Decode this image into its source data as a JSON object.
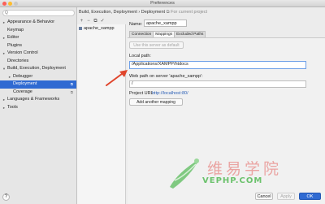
{
  "window": {
    "title": "Preferences"
  },
  "search": {
    "placeholder": "Q"
  },
  "sidebar": {
    "items": [
      {
        "label": "Appearance & Behavior",
        "arrow": "▸",
        "indent": 0,
        "selected": false,
        "badge": ""
      },
      {
        "label": "Keymap",
        "arrow": "",
        "indent": 0,
        "selected": false,
        "badge": ""
      },
      {
        "label": "Editor",
        "arrow": "▸",
        "indent": 0,
        "selected": false,
        "badge": ""
      },
      {
        "label": "Plugins",
        "arrow": "",
        "indent": 0,
        "selected": false,
        "badge": ""
      },
      {
        "label": "Version Control",
        "arrow": "▸",
        "indent": 0,
        "selected": false,
        "badge": ""
      },
      {
        "label": "Directories",
        "arrow": "",
        "indent": 0,
        "selected": false,
        "badge": ""
      },
      {
        "label": "Build, Execution, Deployment",
        "arrow": "▾",
        "indent": 0,
        "selected": false,
        "badge": ""
      },
      {
        "label": "Debugger",
        "arrow": "▸",
        "indent": 1,
        "selected": false,
        "badge": ""
      },
      {
        "label": "Deployment",
        "arrow": "",
        "indent": 1,
        "selected": true,
        "badge": "⧉"
      },
      {
        "label": "Coverage",
        "arrow": "",
        "indent": 1,
        "selected": false,
        "badge": "⧉"
      },
      {
        "label": "Languages & Frameworks",
        "arrow": "▸",
        "indent": 0,
        "selected": false,
        "badge": ""
      },
      {
        "label": "Tools",
        "arrow": "▸",
        "indent": 0,
        "selected": false,
        "badge": ""
      }
    ]
  },
  "breadcrumb": {
    "path": "Build, Execution, Deployment › Deployment",
    "project_note": "⧉ For current project"
  },
  "toolbar": {
    "add": "+",
    "remove": "−",
    "copy": "⧉",
    "default": "✓"
  },
  "server": {
    "name": "apache_xampp"
  },
  "form": {
    "name_label": "Name:",
    "name_value": "apache_xampp",
    "tabs": [
      "Connection",
      "Mappings",
      "Excluded Paths"
    ],
    "use_default_label": "Use this server as default",
    "local_path_label": "Local path:",
    "local_path_value": "/Applications/XAMPP/htdocs",
    "web_path_label": "Web path on server 'apache_xampp':",
    "web_path_value": "/",
    "project_url_label": "Project URL:",
    "project_url_value": "http://localhost:80/",
    "add_mapping_label": "Add another mapping"
  },
  "buttons": {
    "help": "?",
    "cancel": "Cancel",
    "apply": "Apply",
    "ok": "OK"
  },
  "watermark": {
    "chinese": "维易学院",
    "url": "VEPHP.COM"
  },
  "colors": {
    "accent": "#2f6ad2",
    "annotation_arrow": "#e0452c",
    "watermark_text": "#eaa4a2",
    "watermark_url": "#6cc26d"
  }
}
